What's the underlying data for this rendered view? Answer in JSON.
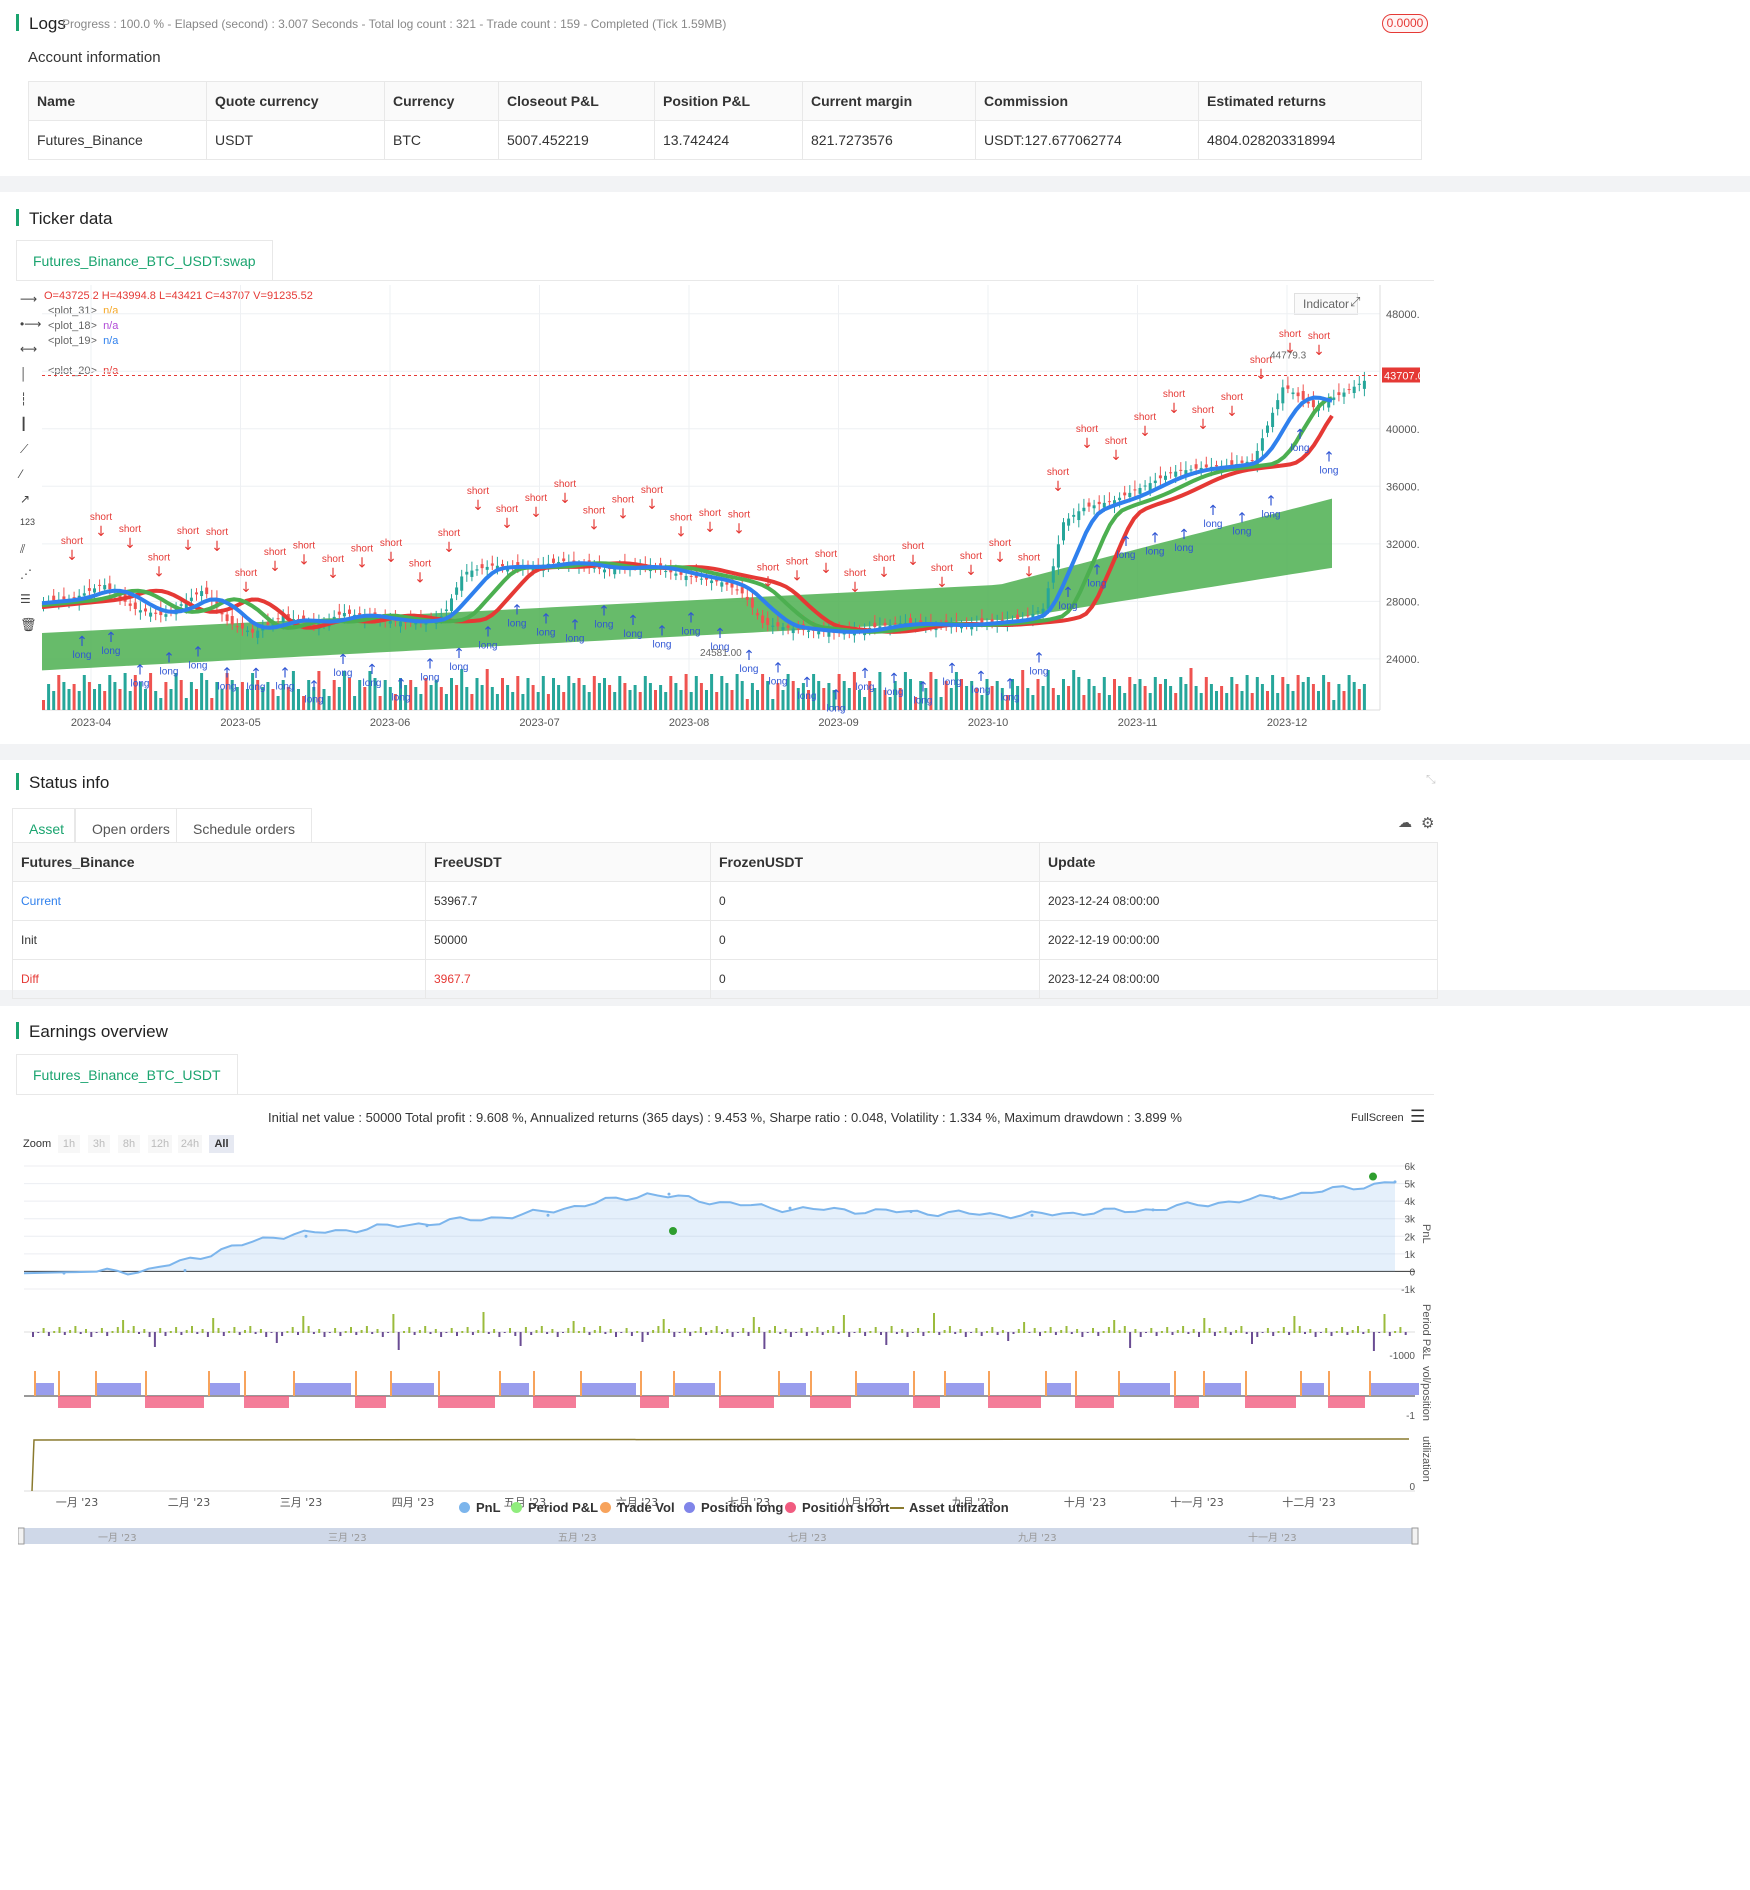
{
  "logs": {
    "title": "Logs",
    "status": "Progress : 100.0 % - Elapsed (second) : 3.007  Seconds - Total log count : 321 - Trade count : 159 - Completed (Tick 1.59MB)",
    "badge": "0.0000"
  },
  "account": {
    "title": "Account information",
    "columns": [
      "Name",
      "Quote currency",
      "Currency",
      "Closeout P&L",
      "Position P&L",
      "Current margin",
      "Commission",
      "Estimated returns"
    ],
    "row": [
      "Futures_Binance",
      "USDT",
      "BTC",
      "5007.452219",
      "13.742424",
      "821.7273576",
      "USDT:127.677062774",
      "4804.028203318994"
    ]
  },
  "ticker": {
    "title": "Ticker data",
    "tab": "Futures_Binance_BTC_USDT:swap",
    "ohlc": "O=43725.2 H=43994.8 L=43421 C=43707 V=91235.52",
    "indicator_btn": "Indicator",
    "plots": [
      {
        "name": "<plot_31>",
        "value": "n/a",
        "color": "#f5a623"
      },
      {
        "name": "<plot_18>",
        "value": "n/a",
        "color": "#b04ad6"
      },
      {
        "name": "<plot_19>",
        "value": "n/a",
        "color": "#2f80ed"
      },
      {
        "name": "<plot_20>",
        "value": "n/a",
        "color": "#e53935"
      }
    ],
    "price_ticks": [
      "48000.00",
      "44000.00",
      "40000.00",
      "36000.00",
      "32000.00",
      "28000.00",
      "24000.00"
    ],
    "last_price": "43707.00",
    "date_ticks": [
      "2023-04",
      "2023-05",
      "2023-06",
      "2023-07",
      "2023-08",
      "2023-09",
      "2023-10",
      "2023-11",
      "2023-12"
    ],
    "low_mark": "24581.00",
    "high_mark": "44779.3"
  },
  "status": {
    "title": "Status info",
    "tabs": [
      "Asset",
      "Open orders",
      "Schedule orders"
    ],
    "columns": [
      "Futures_Binance",
      "FreeUSDT",
      "FrozenUSDT",
      "Update"
    ],
    "rows": [
      [
        "Current",
        "53967.7",
        "0",
        "2023-12-24 08:00:00"
      ],
      [
        "Init",
        "50000",
        "0",
        "2022-12-19 00:00:00"
      ],
      [
        "Diff",
        "3967.7",
        "0",
        "2023-12-24 08:00:00"
      ]
    ]
  },
  "earnings": {
    "title": "Earnings overview",
    "tab": "Futures_Binance_BTC_USDT",
    "summary": "Initial net value : 50000 Total profit : 9.608 %, Annualized returns (365 days) : 9.453 %, Sharpe ratio : 0.048, Volatility : 1.334 %, Maximum drawdown : 3.899 %",
    "fullscreen": "FullScreen",
    "zoom_label": "Zoom",
    "zoom_options": [
      "1h",
      "3h",
      "8h",
      "12h",
      "24h",
      "All"
    ],
    "pnl_ticks": [
      "6k",
      "5k",
      "4k",
      "3k",
      "2k",
      "1k",
      "0",
      "-1k"
    ],
    "pnl_axis": "PnL",
    "period_axis": "Period P&L",
    "period_tick": "-1000",
    "vol_axis": "vol/position",
    "vol_tick": "-1",
    "util_axis": "utilization",
    "util_tick": "0",
    "month_ticks": [
      "一月 '23",
      "二月 '23",
      "三月 '23",
      "四月 '23",
      "五月 '23",
      "六月 '23",
      "七月 '23",
      "八月 '23",
      "九月 '23",
      "十月 '23",
      "十一月 '23",
      "十二月 '23"
    ],
    "nav_ticks": [
      "一月 '23",
      "三月 '23",
      "五月 '23",
      "七月 '23",
      "九月 '23",
      "十一月 '23"
    ],
    "legend": [
      {
        "label": "PnL",
        "color": "#7cb5ec"
      },
      {
        "label": "Period P&L",
        "color": "#90ed7d"
      },
      {
        "label": "Trade Vol",
        "color": "#f7a35c"
      },
      {
        "label": "Position long",
        "color": "#8085e9"
      },
      {
        "label": "Position short",
        "color": "#f15c80"
      },
      {
        "label": "Asset utilization",
        "color": "#8a7a2e"
      }
    ]
  },
  "chart_data": {
    "type": "line",
    "title": "",
    "x": [
      "2023-01",
      "2023-02",
      "2023-03",
      "2023-04",
      "2023-05",
      "2023-06",
      "2023-07",
      "2023-08",
      "2023-09",
      "2023-10",
      "2023-11",
      "2023-12"
    ],
    "series": [
      {
        "name": "PnL",
        "values": [
          -100,
          50,
          2000,
          2600,
          3200,
          4400,
          3600,
          3400,
          3200,
          3500,
          4200,
          5100
        ]
      }
    ],
    "ylim": [
      -1000,
      6000
    ]
  }
}
